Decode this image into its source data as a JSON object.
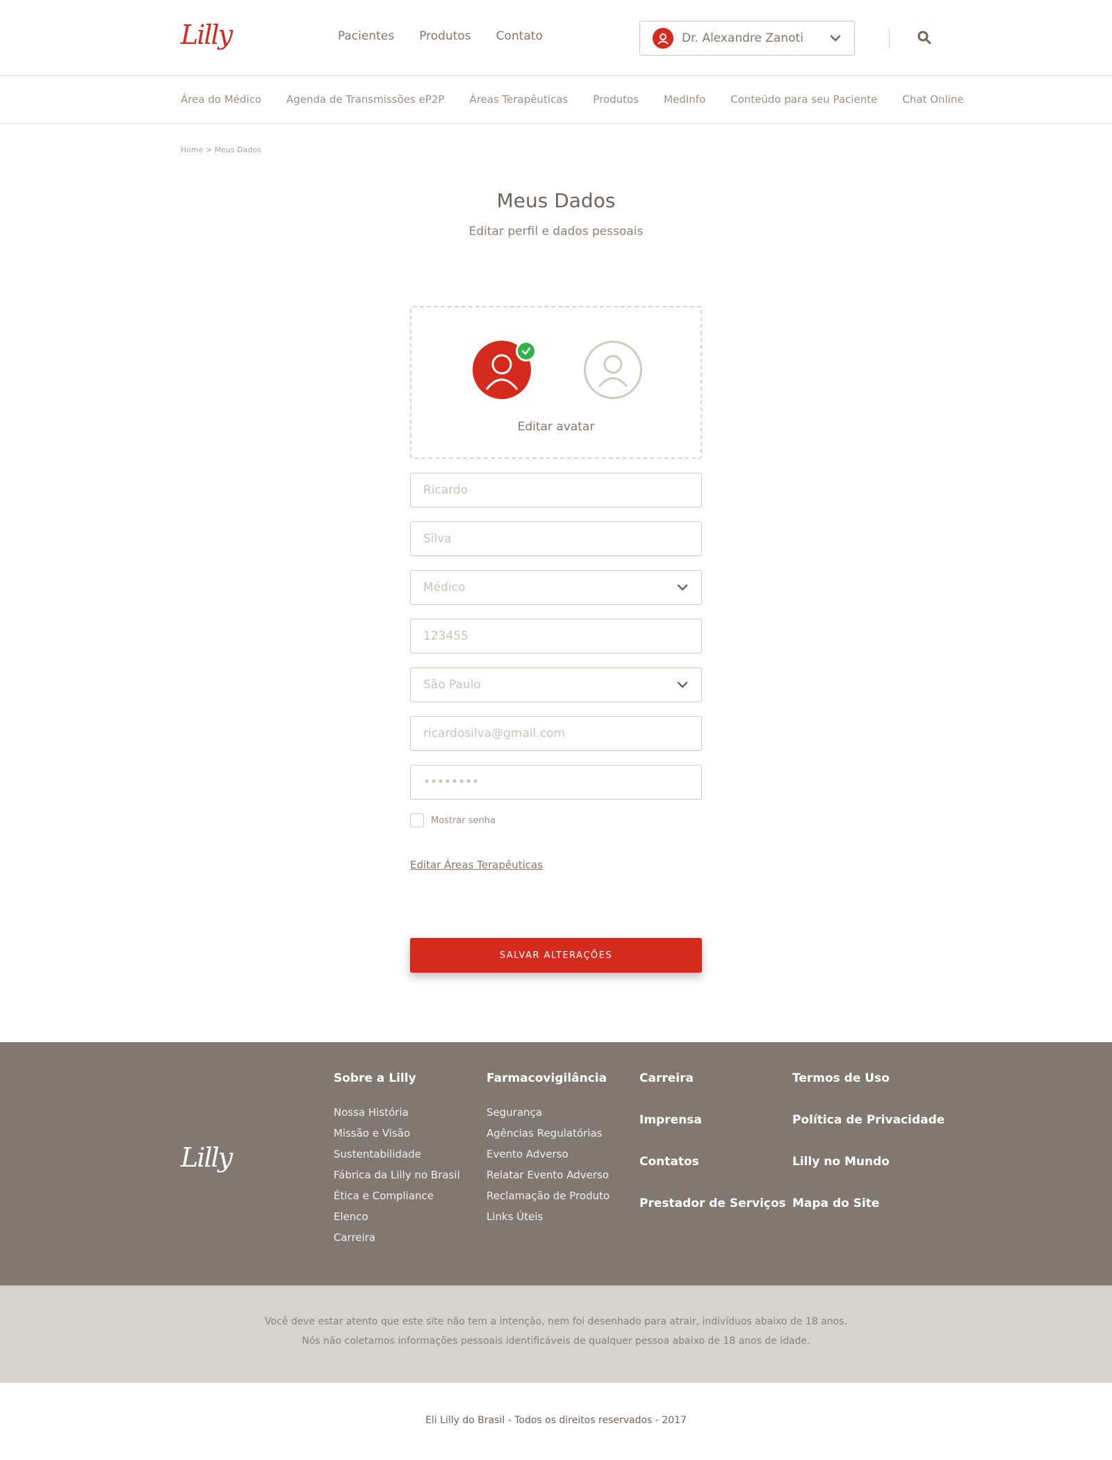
{
  "brand": {
    "logo": "Lilly",
    "accent": "#d52b1e",
    "footer_bg": "#827870"
  },
  "header": {
    "nav": [
      "Pacientes",
      "Produtos",
      "Contato"
    ],
    "user_name": "Dr. Alexandre Zanoti",
    "user_icon": "user-icon",
    "dropdown_icon": "chevron-down-icon",
    "search_icon": "search-icon"
  },
  "subnav": [
    "Área do Médico",
    "Agenda de Transmissões eP2P",
    "Áreas Terapêuticas",
    "Produtos",
    "MedInfo",
    "Conteúdo para seu Paciente",
    "Chat Online"
  ],
  "breadcrumb": "Home > Meus Dados",
  "page": {
    "title": "Meus Dados",
    "subtitle": "Editar perfil e dados pessoais"
  },
  "avatar": {
    "edit_label": "Editar avatar"
  },
  "form": {
    "first_name": "Ricardo",
    "last_name": "Silva",
    "profession": "Médico",
    "crm": "123455",
    "state": "São Paulo",
    "email": "ricardosilva@gmail.com",
    "password": "••••••••",
    "show_password_label": "Mostrar senha",
    "edit_areas_link": "Editar Áreas Terapêuticas",
    "save_label": "SALVAR ALTERAÇÕES"
  },
  "footer": {
    "logo": "Lilly",
    "col1": {
      "title": "Sobre a Lilly",
      "links": [
        "Nossa História",
        "Missão e Visão",
        "Sustentabilidade",
        "Fábrica da Lilly no Brasil",
        "Ética e Compliance",
        "Elenco",
        "Carreira"
      ]
    },
    "col2": {
      "title": "Farmacovigilância",
      "links": [
        "Segurança",
        "Agências Regulatórias",
        "Evento Adverso",
        "Relatar Evento Adverso",
        "Reclamação de Produto",
        "Links Úteis"
      ]
    },
    "col3": [
      "Carreira",
      "Imprensa",
      "Contatos",
      "Prestador de Serviços"
    ],
    "col4": [
      "Termos de Uso",
      "Política de Privacidade",
      "Lilly no Mundo",
      "Mapa do Site"
    ]
  },
  "notice": {
    "line1": "Você deve estar atento que este site não tem a intenção, nem foi desenhado para atrair, indivíduos abaixo de 18 anos.",
    "line2": "Nós não coletamos informações pessoais identificáveis de qualquer pessoa abaixo de 18 anos de idade."
  },
  "copyright": "Eli Lilly do Brasil - Todos os direitos reservados - 2017"
}
